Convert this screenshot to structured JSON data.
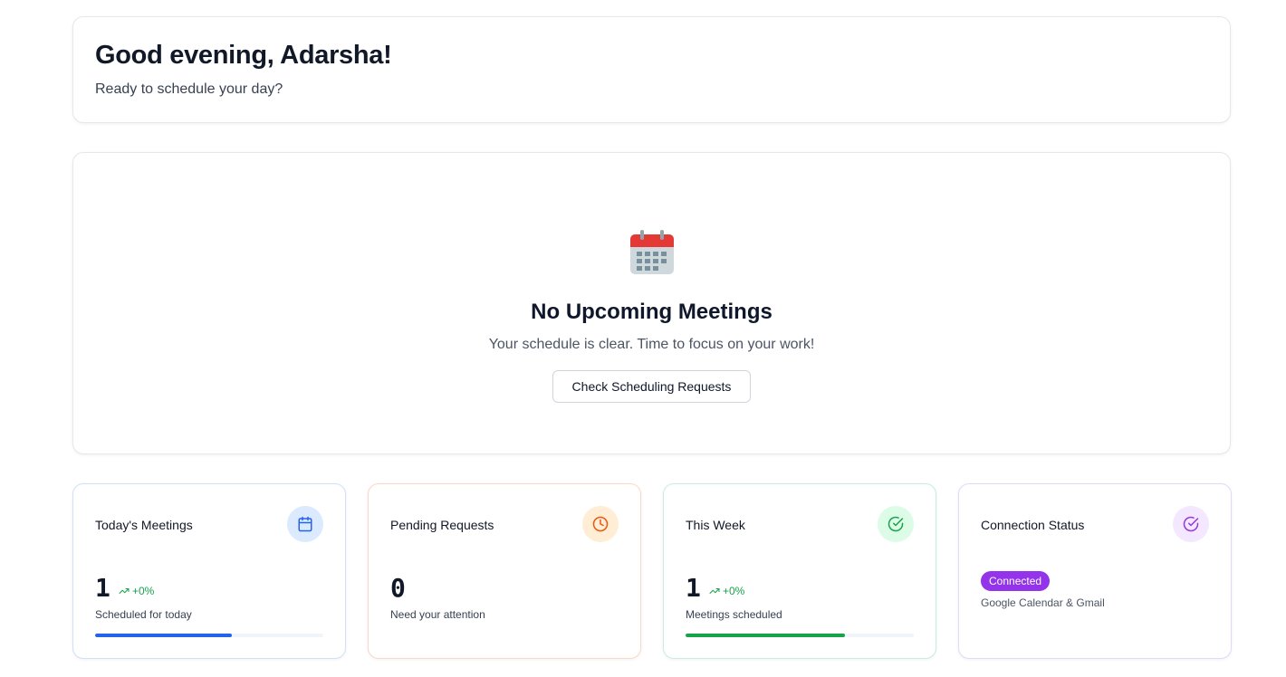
{
  "greeting": {
    "title": "Good evening, Adarsha!",
    "subtitle": "Ready to schedule your day?"
  },
  "empty_state": {
    "icon": "calendar-icon",
    "title": "No Upcoming Meetings",
    "message": "Your schedule is clear. Time to focus on your work!",
    "button_label": "Check Scheduling Requests"
  },
  "stats": [
    {
      "title": "Today's Meetings",
      "value": "1",
      "trend": "+0%",
      "description": "Scheduled for today",
      "icon": "calendar-icon",
      "progress_percent": 60,
      "accent": "#2563eb"
    },
    {
      "title": "Pending Requests",
      "value": "0",
      "description": "Need your attention",
      "icon": "clock-icon",
      "accent": "#ea580c"
    },
    {
      "title": "This Week",
      "value": "1",
      "trend": "+0%",
      "description": "Meetings scheduled",
      "icon": "check-circle-icon",
      "progress_percent": 70,
      "accent": "#16a34a"
    },
    {
      "title": "Connection Status",
      "badge": "Connected",
      "description": "Google Calendar & Gmail",
      "icon": "check-circle-icon",
      "accent": "#9333ea"
    }
  ]
}
